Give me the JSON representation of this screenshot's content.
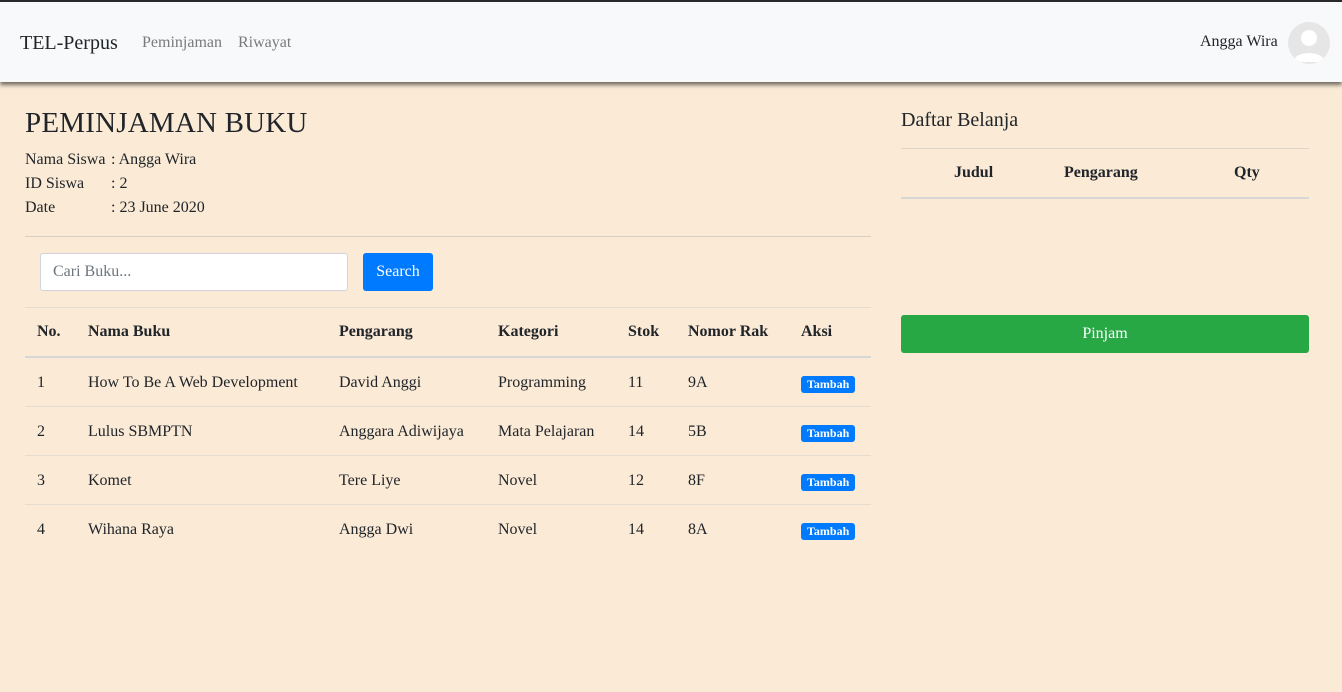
{
  "navbar": {
    "brand": "TEL-Perpus",
    "links": [
      "Peminjaman",
      "Riwayat"
    ],
    "user_name": "Angga Wira",
    "avatar_icon": "user-avatar-icon"
  },
  "page": {
    "title": "PEMINJAMAN BUKU",
    "info": [
      {
        "label": "Nama Siswa",
        "value": ": Angga Wira"
      },
      {
        "label": "ID Siswa",
        "value": ": 2"
      },
      {
        "label": "Date",
        "value": ": 23 June 2020"
      }
    ]
  },
  "search": {
    "placeholder": "Cari Buku...",
    "value": "",
    "button_label": "Search"
  },
  "books_table": {
    "headers": [
      "No.",
      "Nama Buku",
      "Pengarang",
      "Kategori",
      "Stok",
      "Nomor Rak",
      "Aksi"
    ],
    "rows": [
      {
        "no": "1",
        "nama": "How To Be A Web Development",
        "pengarang": "David Anggi",
        "kategori": "Programming",
        "stok": "11",
        "rak": "9A",
        "aksi": "Tambah"
      },
      {
        "no": "2",
        "nama": "Lulus SBMPTN",
        "pengarang": "Anggara Adiwijaya",
        "kategori": "Mata Pelajaran",
        "stok": "14",
        "rak": "5B",
        "aksi": "Tambah"
      },
      {
        "no": "3",
        "nama": "Komet",
        "pengarang": "Tere Liye",
        "kategori": "Novel",
        "stok": "12",
        "rak": "8F",
        "aksi": "Tambah"
      },
      {
        "no": "4",
        "nama": "Wihana Raya",
        "pengarang": "Angga Dwi",
        "kategori": "Novel",
        "stok": "14",
        "rak": "8A",
        "aksi": "Tambah"
      }
    ]
  },
  "cart": {
    "title": "Daftar Belanja",
    "headers": [
      "Judul",
      "Pengarang",
      "Qty"
    ],
    "button_label": "Pinjam"
  },
  "colors": {
    "page_bg": "#faead6",
    "navbar_bg": "#f8f9fa",
    "primary": "#007bff",
    "success": "#28a745"
  }
}
